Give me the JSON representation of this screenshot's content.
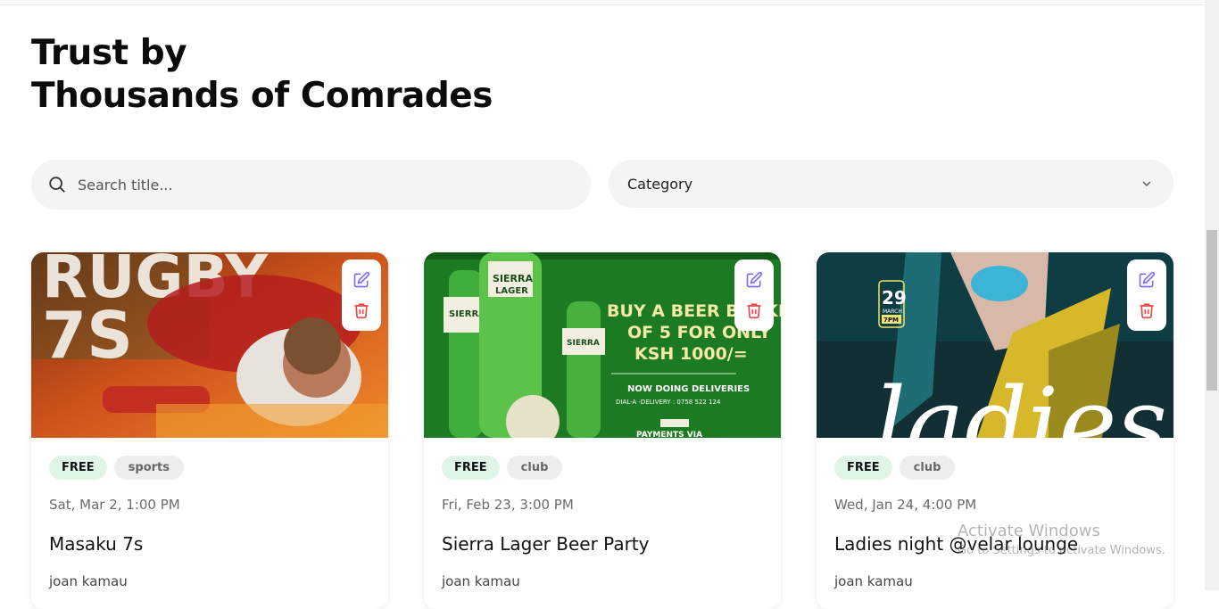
{
  "heading": {
    "line1": "Trust by",
    "line2": "Thousands of Comrades"
  },
  "search": {
    "placeholder": "Search title..."
  },
  "category": {
    "label": "Category"
  },
  "cards": [
    {
      "price": "FREE",
      "category": "sports",
      "date": "Sat, Mar 2, 1:00 PM",
      "title": "Masaku 7s",
      "organizer": "joan kamau",
      "image_text": "RUGBY 7S"
    },
    {
      "price": "FREE",
      "category": "club",
      "date": "Fri, Feb 23, 3:00 PM",
      "title": "Sierra Lager Beer Party",
      "organizer": "joan kamau",
      "image_text": {
        "brand": "SIERRA LAGER",
        "l1": "BUY A BEER BUCKET",
        "l2": "OF 5 FOR ONLY",
        "l3": "KSH 1000/=",
        "l4": "NOW DOING DELIVERIES",
        "l5": "DIAL-A -DELIVERY : 0758 522 124",
        "l6": "PAYMENTS VIA"
      }
    },
    {
      "price": "FREE",
      "category": "club",
      "date": "Wed, Jan 24, 4:00 PM",
      "title": "Ladies night @velar lounge",
      "organizer": "joan kamau",
      "image_text": {
        "day": "29",
        "month": "MARCH",
        "time": "7PM",
        "script": "ladies"
      }
    }
  ],
  "watermark": {
    "line1": "Activate Windows",
    "line2": "Go to Settings to activate Windows."
  },
  "colors": {
    "free_tag": "#dff5e5",
    "edit_icon": "#7b6cf6",
    "delete_icon": "#ef4444"
  },
  "icons": [
    "search-icon",
    "chevron-down-icon",
    "edit-icon",
    "trash-icon"
  ]
}
